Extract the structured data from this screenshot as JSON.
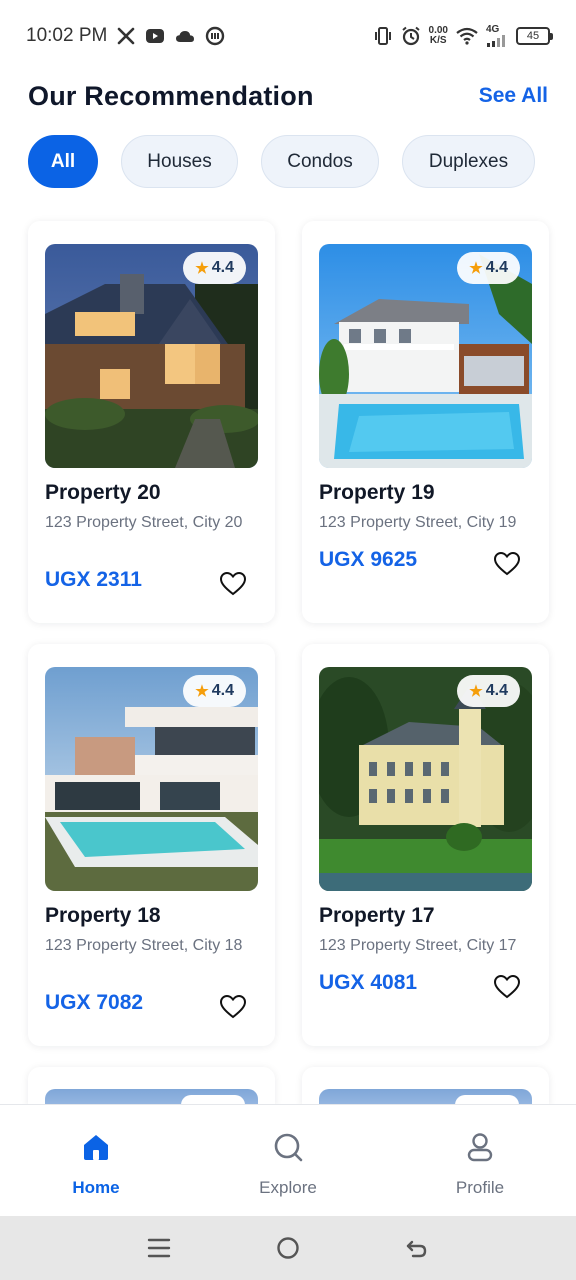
{
  "status_bar": {
    "time": "10:02 PM",
    "net_speed_value": "0.00",
    "net_speed_unit": "K/S",
    "network": "4G",
    "battery": "45",
    "left_icons": [
      "x-logo-icon",
      "youtube-icon",
      "cloud-icon",
      "app-icon"
    ],
    "right_icons": [
      "vibrate-icon",
      "alarm-icon",
      "wifi-icon",
      "signal-icon",
      "battery-icon"
    ]
  },
  "header": {
    "title": "Our Recommendation",
    "see_all": "See All"
  },
  "filters": [
    {
      "label": "All",
      "active": true
    },
    {
      "label": "Houses",
      "active": false
    },
    {
      "label": "Condos",
      "active": false
    },
    {
      "label": "Duplexes",
      "active": false
    }
  ],
  "properties": [
    {
      "name": "Property 20",
      "address": "123 Property Street, City 20",
      "price": "UGX 2311",
      "rating": "4.4",
      "image": "wooden-house-night"
    },
    {
      "name": "Property 19",
      "address": "123 Property Street, City 19",
      "price": "UGX 9625",
      "rating": "4.4",
      "image": "white-villa-pool"
    },
    {
      "name": "Property 18",
      "address": "123 Property Street, City 18",
      "price": "UGX 7082",
      "rating": "4.4",
      "image": "modern-house-pool"
    },
    {
      "name": "Property 17",
      "address": "123 Property Street, City 17",
      "price": "UGX 4081",
      "rating": "4.4",
      "image": "castle-mansion-lake"
    }
  ],
  "bottom_nav": [
    {
      "label": "Home",
      "icon": "home-icon",
      "active": true
    },
    {
      "label": "Explore",
      "icon": "search-icon",
      "active": false
    },
    {
      "label": "Profile",
      "icon": "profile-icon",
      "active": false
    }
  ],
  "system_nav": [
    "menu-icon",
    "home-circle-icon",
    "back-icon"
  ],
  "colors": {
    "accent": "#0b63e5",
    "price": "#1463e6",
    "star": "#f59e0b",
    "chip_bg": "#eef3fa"
  }
}
